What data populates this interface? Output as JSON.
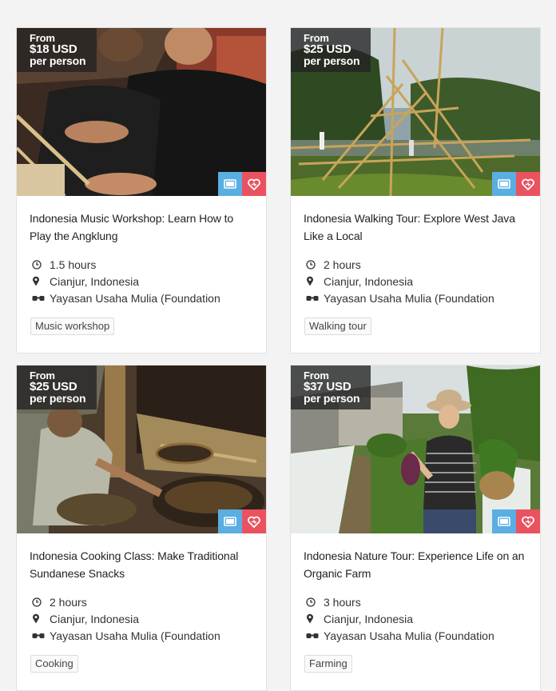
{
  "cards": [
    {
      "price_from": "From",
      "price_amount": "$18 USD",
      "price_per": "per person",
      "title": "Indonesia Music Workshop: Learn How to Play the Angklung",
      "duration": "1.5 hours",
      "location": "Cianjur, Indonesia",
      "host": "Yayasan Usaha Mulia (Foundation",
      "tag": "Music workshop"
    },
    {
      "price_from": "From",
      "price_amount": "$25 USD",
      "price_per": "per person",
      "title": "Indonesia Walking Tour: Explore West Java Like a Local",
      "duration": "2 hours",
      "location": "Cianjur, Indonesia",
      "host": "Yayasan Usaha Mulia (Foundation",
      "tag": "Walking tour"
    },
    {
      "price_from": "From",
      "price_amount": "$25 USD",
      "price_per": "per person",
      "title": "Indonesia Cooking Class: Make Traditional Sundanese Snacks",
      "duration": "2 hours",
      "location": "Cianjur, Indonesia",
      "host": "Yayasan Usaha Mulia (Foundation",
      "tag": "Cooking"
    },
    {
      "price_from": "From",
      "price_amount": "$37 USD",
      "price_per": "per person",
      "title": "Indonesia Nature Tour: Experience Life on an Organic Farm",
      "duration": "3 hours",
      "location": "Cianjur, Indonesia",
      "host": "Yayasan Usaha Mulia (Foundation",
      "tag": "Farming"
    }
  ],
  "icons": {
    "duration": "clock-icon",
    "location": "map-pin-icon",
    "host": "host-glasses-icon",
    "info": "info-card-icon",
    "like": "heart-icon"
  },
  "colors": {
    "info_button": "#5aaee2",
    "like_button": "#ea5260",
    "price_badge": "#222222"
  }
}
